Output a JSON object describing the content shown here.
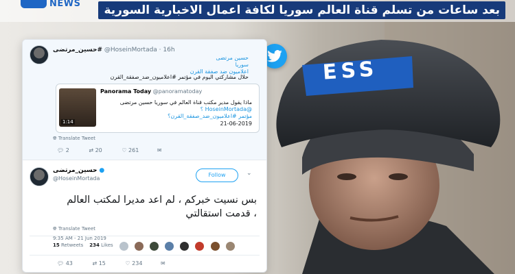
{
  "header": {
    "logo_text": "NEWS",
    "headline": "بعد ساعات من تسلم قناة العالم سوريا لكافة اعمال الاخبارية السورية"
  },
  "photo": {
    "helmet_text": "ESS",
    "description_icon": "press-helmet-man"
  },
  "tweet1": {
    "name": "حسين_مرتضى#",
    "handle": "@HoseinMortada · 16h",
    "meta1": "حسين مرتضى",
    "meta2": "سوريا",
    "meta3": "اعلاميون ضد صفقة القرن",
    "text": "حلال مشاركتي اليوم في مؤتمر #اعلاميون_ضد_صفقة_القرن",
    "quote_author": "Panorama Today",
    "quote_handle": "@panoramatoday",
    "quote_line1": "ماذا يقول مدير مكتب قناة العالم في سوريا حسين مرتضى",
    "quote_line2": "@HoseinMortada ؟",
    "quote_line3": "مؤتمر #اعلاميون_ضد_صفقة_القرن؟",
    "quote_date": "21-06-2019",
    "video_time": "1:14",
    "translate": "Translate Tweet",
    "replies": "2",
    "retweets": "20",
    "likes": "261"
  },
  "tweet2": {
    "name": "حسين_مرتضى",
    "handle": "@HoseinMortada",
    "follow_label": "Follow",
    "text_line1": "بس نسيت خبركم ، لم اعد مديرا لمكتب العالم",
    "text_line2": "، قدمت استقالتي",
    "translate": "Translate Tweet",
    "timestamp": "9:35 AM - 21 Jun 2019",
    "retweets_count": "15",
    "retweets_label": "Retweets",
    "likes_count": "234",
    "likes_label": "Likes",
    "replies": "43",
    "retweet_action": "15",
    "like_action": "234"
  },
  "colors": {
    "headline_bg": "#173a7a",
    "twitter_blue": "#1da1f2",
    "helmet_band": "#1f5fbf"
  }
}
